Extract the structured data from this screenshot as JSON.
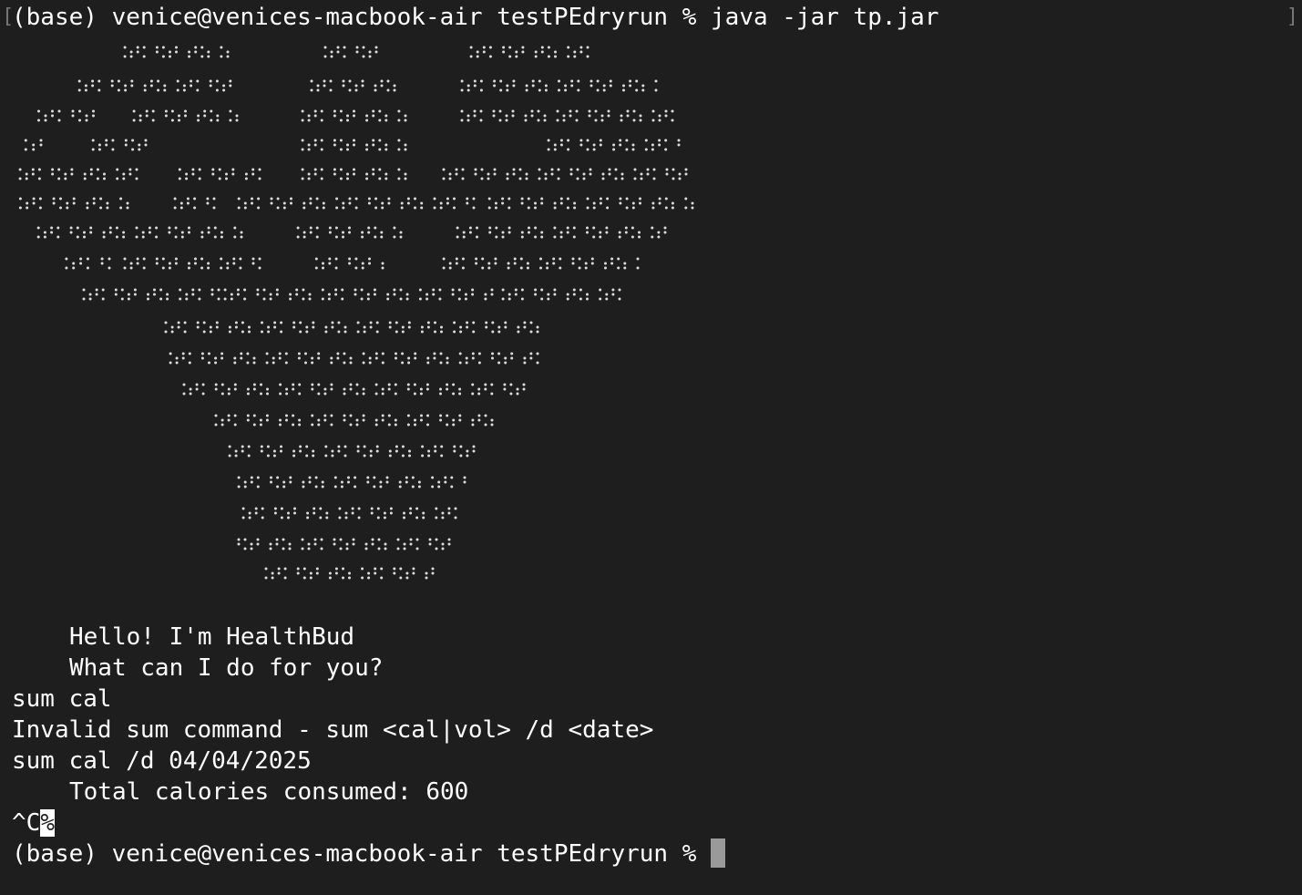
{
  "terminal": {
    "colors": {
      "background": "#1e1e1e",
      "foreground": "#ffffff",
      "cursor": "#9a9a9a"
    },
    "command_line": "(base) venice@venices-macbook-air testPEdryrun % java -jar tp.jar",
    "banner_art": "ASCII-art ox/bull head logo drawn with braille dot characters",
    "greeting_1": "Hello! I'm HealthBud",
    "greeting_2": "What can I do for you?",
    "input_1": "sum cal",
    "error_1": "Invalid sum command - sum <cal|vol> /d <date>",
    "input_2": "sum cal /d 04/04/2025",
    "output_1": "Total calories consumed: 600",
    "interrupt": "^C",
    "interrupt_marker": "%",
    "final_prompt": "(base) venice@venices-macbook-air testPEdryrun %"
  }
}
